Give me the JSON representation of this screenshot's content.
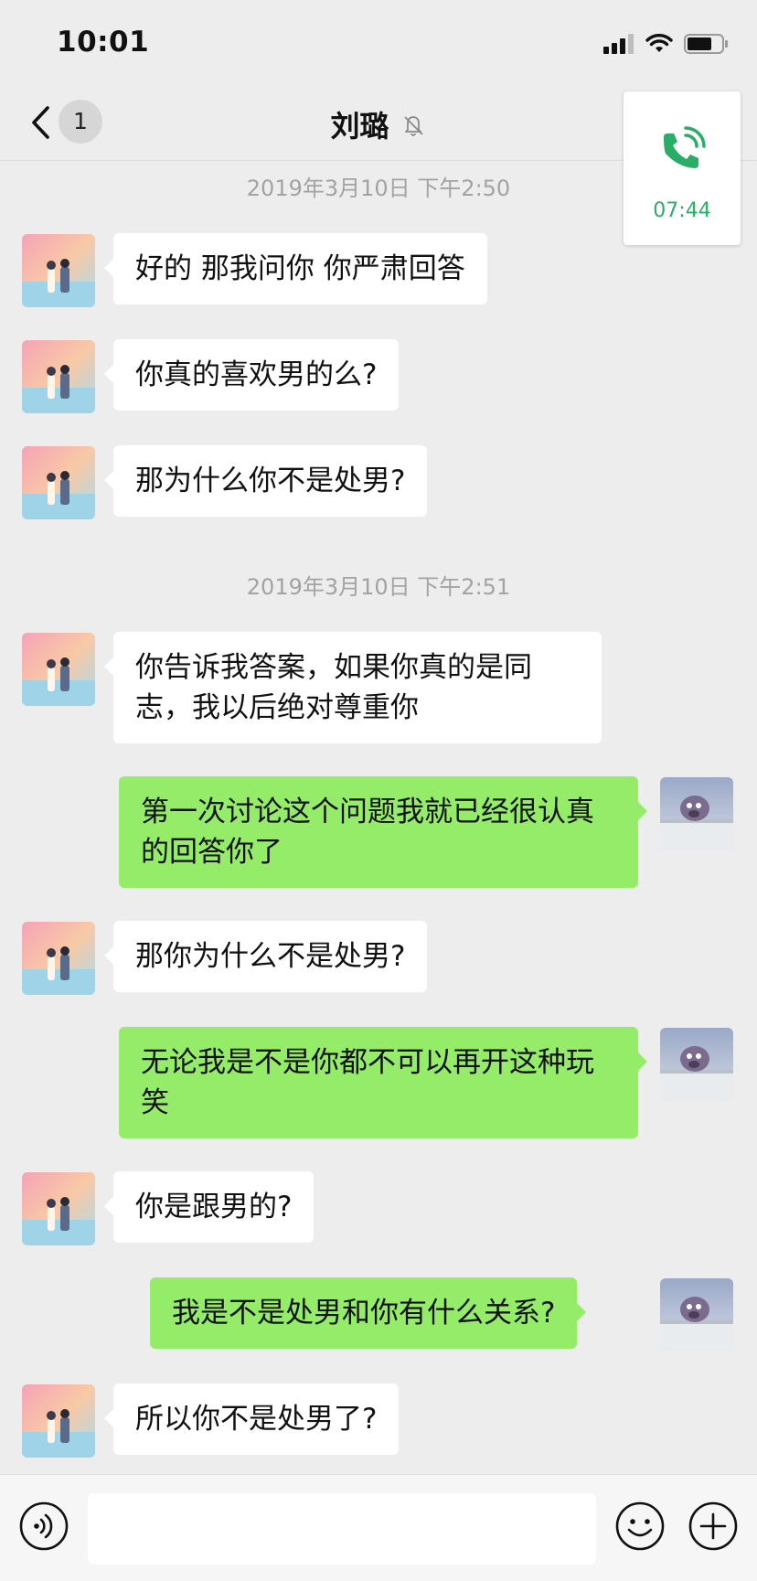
{
  "status_bar": {
    "time": "10:01"
  },
  "header": {
    "back_unread_count": "1",
    "title": "刘璐"
  },
  "floating_call": {
    "duration": "07:44"
  },
  "timestamps": [
    "2019年3月10日 下午2:50",
    "2019年3月10日 下午2:51"
  ],
  "messages": [
    {
      "sender": "contact",
      "text": "好的 那我问你 你严肃回答"
    },
    {
      "sender": "contact",
      "text": "你真的喜欢男的么?"
    },
    {
      "sender": "contact",
      "text": "那为什么你不是处男?"
    },
    {
      "sender": "contact",
      "text": "你告诉我答案，如果你真的是同志，我以后绝对尊重你"
    },
    {
      "sender": "me",
      "text": "第一次讨论这个问题我就已经很认真的回答你了"
    },
    {
      "sender": "contact",
      "text": "那你为什么不是处男?"
    },
    {
      "sender": "me",
      "text": "无论我是不是你都不可以再开这种玩笑"
    },
    {
      "sender": "contact",
      "text": "你是跟男的?"
    },
    {
      "sender": "me",
      "text": "我是不是处男和你有什么关系?"
    },
    {
      "sender": "contact",
      "text": "所以你不是处男了?"
    }
  ],
  "input_bar": {
    "voice_icon": "voice-icon",
    "emoji_icon": "emoji-icon",
    "plus_icon": "plus-icon"
  },
  "colors": {
    "background": "#ededed",
    "sent_bubble": "#95ec69",
    "received_bubble": "#ffffff",
    "call_green": "#2aae67"
  }
}
